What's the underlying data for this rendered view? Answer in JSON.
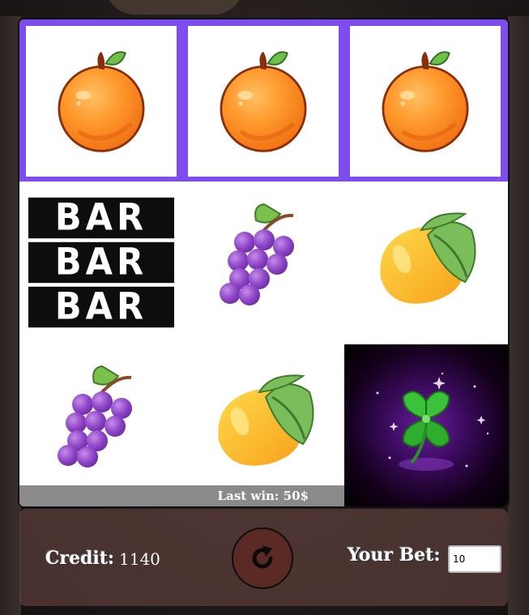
{
  "reels": {
    "row1": [
      "orange",
      "orange",
      "orange"
    ],
    "row2": [
      "bar",
      "grapes",
      "lemon"
    ],
    "row3": [
      "grapes",
      "lemon",
      "clover"
    ],
    "bar_text": "BAR",
    "win_highlight_color": "#7d4df0"
  },
  "last_win": {
    "text": "Last win: 50$"
  },
  "footer": {
    "credit_label": "Credit:",
    "credit_value": "1140",
    "spin_icon": "refresh-icon",
    "bet_label": "Your Bet:",
    "bet_value": "10"
  }
}
